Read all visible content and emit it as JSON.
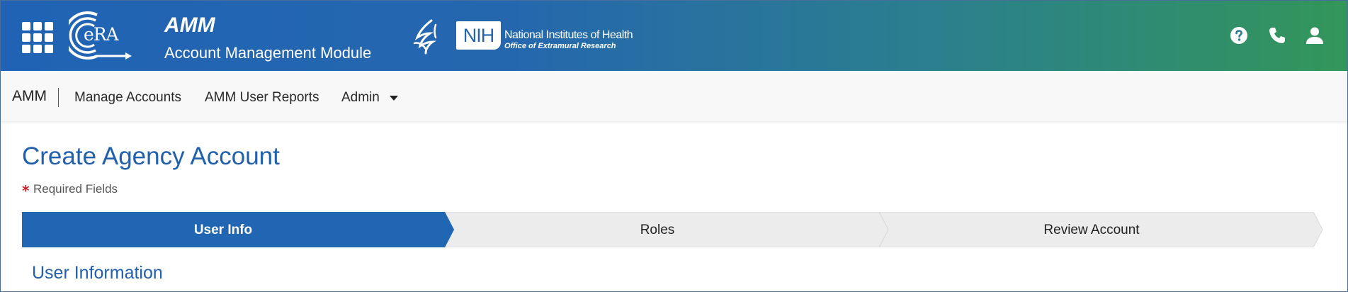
{
  "header": {
    "logo_text": "eRA",
    "app_title": "AMM",
    "app_subtitle": "Account Management Module",
    "nih_abbr": "NIH",
    "nih_name": "National Institutes of Health",
    "nih_office": "Office of Extramural Research",
    "icons": [
      "apps-grid-icon",
      "help-icon",
      "phone-icon",
      "user-icon"
    ]
  },
  "nav": {
    "brand": "AMM",
    "items": [
      {
        "label": "Manage Accounts"
      },
      {
        "label": "AMM User Reports"
      },
      {
        "label": "Admin"
      }
    ]
  },
  "main": {
    "title": "Create Agency Account",
    "required_marker": "*",
    "required_text": "Required Fields",
    "steps": [
      {
        "label": "User Info",
        "active": true
      },
      {
        "label": "Roles",
        "active": false
      },
      {
        "label": "Review Account",
        "active": false
      }
    ],
    "section_title": "User Information"
  },
  "colors": {
    "primary": "#2160ac",
    "header_start": "#2063b4",
    "header_end": "#339659",
    "required": "#c0242c",
    "step_inactive": "#ececec"
  }
}
